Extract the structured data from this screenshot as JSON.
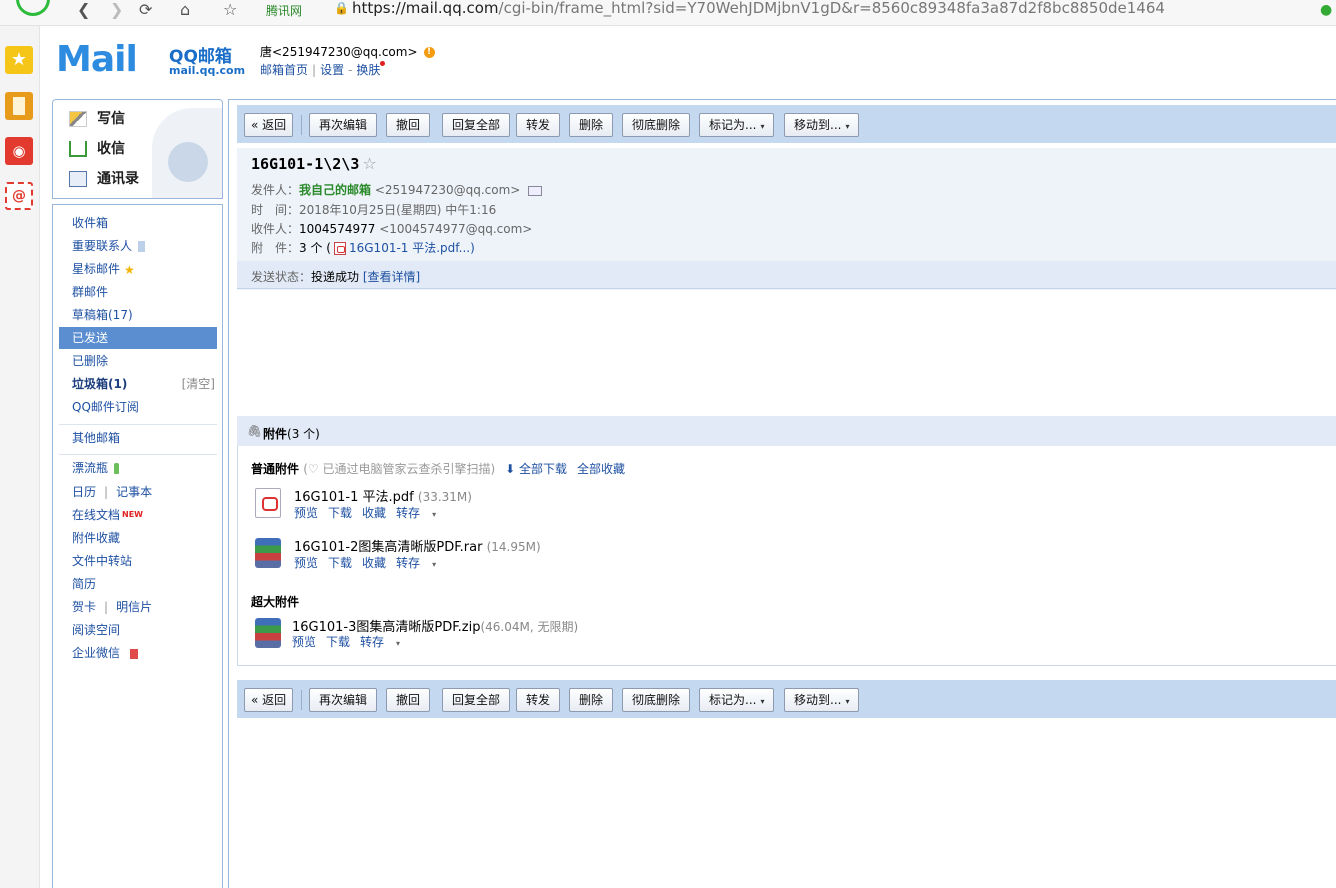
{
  "browser": {
    "brand": "腾讯网",
    "url_host": "https://mail.qq.com",
    "url_path": "/cgi-bin/frame_html?sid=Y70WehJDMjbnV1gD&r=8560c89348fa3a87d2f8bc8850de1464"
  },
  "header": {
    "logo_word": "Mail",
    "logo_title": "QQ邮箱",
    "logo_domain": "mail.qq.com",
    "user": "唐<251947230@qq.com>",
    "warn": "!",
    "links": [
      "邮箱首页",
      "设置",
      "换肤"
    ],
    "sep1": "|",
    "sep2": "-"
  },
  "quick_actions": [
    "写信",
    "收信",
    "通讯录"
  ],
  "sidebar": {
    "items": [
      {
        "label": "收件箱"
      },
      {
        "label": "重要联系人"
      },
      {
        "label": "星标邮件"
      },
      {
        "label": "群邮件"
      },
      {
        "label": "草稿箱(17)"
      },
      {
        "label": "已发送"
      },
      {
        "label": "已删除"
      },
      {
        "label": "垃圾箱(1)",
        "extra": "[清空]"
      },
      {
        "label": "QQ邮件订阅"
      },
      {
        "label": "其他邮箱"
      },
      {
        "label": "漂流瓶"
      },
      {
        "label": "日历",
        "label2": "记事本"
      },
      {
        "label": "在线文档",
        "tag": "NEW"
      },
      {
        "label": "附件收藏"
      },
      {
        "label": "文件中转站"
      },
      {
        "label": "简历"
      },
      {
        "label": "贺卡",
        "label2": "明信片"
      },
      {
        "label": "阅读空间"
      },
      {
        "label": "企业微信"
      }
    ],
    "pipe": "|"
  },
  "toolbar": {
    "back": "« 返回",
    "buttons": [
      "再次编辑",
      "撤回",
      "回复全部",
      "转发",
      "删除",
      "彻底删除",
      "标记为...",
      "移动到..."
    ],
    "caret": "▾"
  },
  "mail": {
    "subject": "16G101-1\\2\\3",
    "star": "☆",
    "from_label": "发件人：",
    "from_name": "我自己的邮箱",
    "from_addr": "<251947230@qq.com>",
    "time_label": "时　间：",
    "time_value": "2018年10月25日(星期四) 中午1:16",
    "to_label": "收件人：",
    "to_name": "1004574977",
    "to_addr": "<1004574977@qq.com>",
    "att_label": "附　件：",
    "att_count": "3 个",
    "att_open": "(",
    "att_file": "16G101-1 平法.pdf...)",
    "status_label": "发送状态：",
    "status_value": "投递成功",
    "status_link": "[查看详情]"
  },
  "attachments": {
    "title": "附件",
    "count": "(3 个)",
    "normal_title": "普通附件",
    "normal_note": "(♡ 已通过电脑管家云查杀引擎扫描)",
    "download_all": "⬇ 全部下载",
    "save_all": "全部收藏",
    "files": [
      {
        "name": "16G101-1 平法.pdf",
        "size": "(33.31M)",
        "acts": [
          "预览",
          "下载",
          "收藏",
          "转存"
        ]
      },
      {
        "name": "16G101-2图集高清晰版PDF.rar",
        "size": "(14.95M)",
        "acts": [
          "预览",
          "下载",
          "收藏",
          "转存"
        ]
      }
    ],
    "big_title": "超大附件",
    "big_file": {
      "name": "16G101-3图集高清晰版PDF.zip",
      "size": "(46.04M, 无限期)",
      "acts": [
        "预览",
        "下载",
        "转存"
      ]
    }
  }
}
